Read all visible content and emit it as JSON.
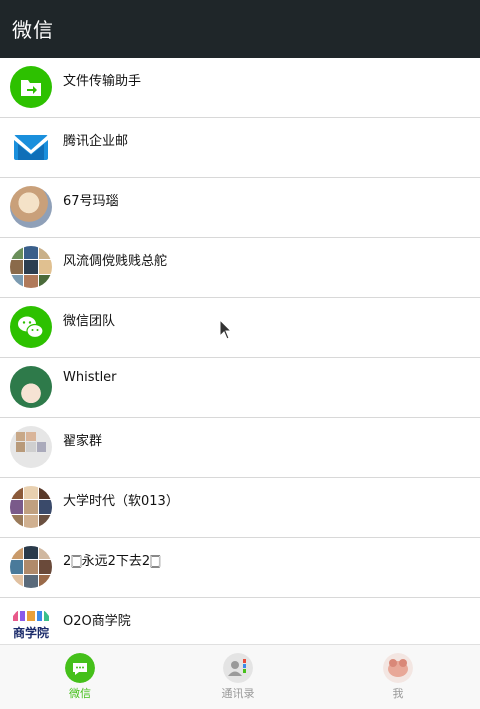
{
  "header": {
    "title": "微信"
  },
  "chats": [
    {
      "name": "文件传输助手",
      "avatar": "file-transfer-icon"
    },
    {
      "name": "腾讯企业邮",
      "avatar": "tencent-mail-icon"
    },
    {
      "name": "67号玛瑙",
      "avatar": "user-avatar"
    },
    {
      "name": "风流倜傥贱贱总舵",
      "avatar": "group-avatar"
    },
    {
      "name": "微信团队",
      "avatar": "wechat-team-icon"
    },
    {
      "name": "Whistler",
      "avatar": "user-avatar"
    },
    {
      "name": "翟家群",
      "avatar": "group-avatar"
    },
    {
      "name": "大学时代（软013）",
      "avatar": "group-avatar"
    },
    {
      "name": "2🀆永远2下去2🀆",
      "avatar": "group-avatar"
    },
    {
      "name": "O2O商学院",
      "avatar": "o2o-logo",
      "logo_text": "O2O 商学院"
    }
  ],
  "tabbar": {
    "items": [
      {
        "label": "微信",
        "active": true
      },
      {
        "label": "通讯录",
        "active": false
      },
      {
        "label": "我",
        "active": false
      }
    ]
  },
  "colors": {
    "accent": "#45c01a",
    "header_bg": "#1f2629"
  }
}
